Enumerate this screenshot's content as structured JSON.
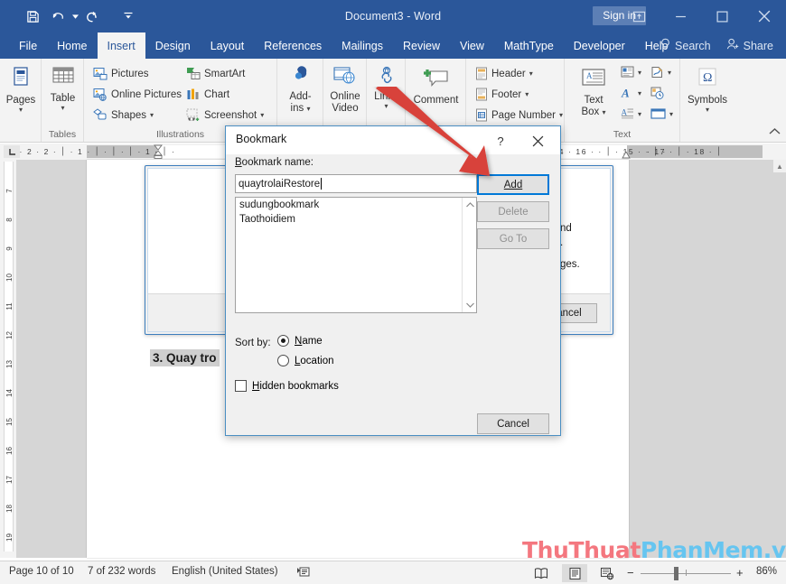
{
  "titlebar": {
    "document_title": "Document3 - Word",
    "sign_in": "Sign in",
    "qat": [
      "save-icon",
      "undo-icon",
      "redo-icon",
      "customize-qat-icon"
    ],
    "window_buttons": [
      "ribbon-display-options-icon",
      "minimize-icon",
      "maximize-icon",
      "close-icon"
    ]
  },
  "ribbon_tabs": {
    "items": [
      {
        "label": "File",
        "active": false
      },
      {
        "label": "Home",
        "active": false
      },
      {
        "label": "Insert",
        "active": true
      },
      {
        "label": "Design",
        "active": false
      },
      {
        "label": "Layout",
        "active": false
      },
      {
        "label": "References",
        "active": false
      },
      {
        "label": "Mailings",
        "active": false
      },
      {
        "label": "Review",
        "active": false
      },
      {
        "label": "View",
        "active": false
      },
      {
        "label": "MathType",
        "active": false
      },
      {
        "label": "Developer",
        "active": false
      },
      {
        "label": "Help",
        "active": false
      }
    ],
    "search": "Search",
    "share": "Share"
  },
  "ribbon": {
    "groups": [
      {
        "name": "Pages",
        "label": ""
      },
      {
        "name": "Tables",
        "label": "Tables"
      },
      {
        "name": "Illustrations",
        "label": "Illustrations"
      },
      {
        "name": "AddIns",
        "label": ""
      },
      {
        "name": "Media",
        "label": ""
      },
      {
        "name": "Links",
        "label": ""
      },
      {
        "name": "Comments",
        "label": ""
      },
      {
        "name": "HeaderFooter",
        "label": ""
      },
      {
        "name": "Text",
        "label": "Text"
      },
      {
        "name": "Symbols",
        "label": ""
      }
    ],
    "pages_button": "Pages",
    "table_button": "Table",
    "pictures": "Pictures",
    "online_pictures": "Online Pictures",
    "shapes": "Shapes",
    "smartart": "SmartArt",
    "chart": "Chart",
    "screenshot": "Screenshot",
    "addins": "Add-ins",
    "online_video_line1": "Online",
    "online_video_line2": "Video",
    "links": "Links",
    "comment": "Comment",
    "header": "Header",
    "footer": "Footer",
    "page_number": "Page Number",
    "text_box_line1": "Text",
    "text_box_line2": "Box",
    "symbols": "Symbols",
    "group_label_tables": "Tables",
    "group_label_illustrations": "Illustrations",
    "group_label_text": "Text",
    "collapse_icon": "chevron-up-icon"
  },
  "ruler": {
    "horizontal": "·  2  ·  ׀  ·  1  ·  ׀  ·  ׀  ·  ׀  ·  1  ·  ׀  ·  2  ·",
    "horizontal_right": "·  14  ·  ׀  ·  · 15  ·  ׀  ·  · 16  ·",
    "horizontal_right2": "·  17  ·   ׀   · 18  ·  ׀",
    "vertical": [
      "7",
      "8",
      "9",
      "10",
      "11",
      "12",
      "13",
      "14",
      "15",
      "16",
      "17",
      "18",
      "19"
    ]
  },
  "document": {
    "heading": "3. Quay tro",
    "bg_dialog_line1": "nd",
    "bg_dialog_line2": ".",
    "bg_dialog_line3": "ges.",
    "bg_dialog_cancel": "ancel"
  },
  "bookmark_dialog": {
    "title": "Bookmark",
    "help_icon": "question-mark-icon",
    "close_icon": "close-icon",
    "name_label": "Bookmark name:",
    "name_value": "quaytrolaiRestore",
    "bookmarks": [
      "sudungbookmark",
      "Taothoidiem"
    ],
    "buttons": {
      "add": "Add",
      "delete": "Delete",
      "goto": "Go To",
      "cancel": "Cancel"
    },
    "sort_by_label": "Sort by:",
    "sort_options": [
      {
        "label": "Name",
        "selected": true
      },
      {
        "label": "Location",
        "selected": false
      }
    ],
    "hidden_bookmarks_label": "Hidden bookmarks",
    "hidden_bookmarks_checked": false,
    "accent_color": "#0078d7"
  },
  "annotation": {
    "arrow_color": "#d8423a",
    "arrow_name": "red-pointer-arrow"
  },
  "watermark": {
    "part1": "ThuThuat",
    "part2": "PhanMem",
    "part3": ".vn",
    "color1": "#f4777f",
    "color2": "#66c5f0"
  },
  "statusbar": {
    "page": "Page 10 of 10",
    "words": "7 of 232 words",
    "language": "English (United States)",
    "proofing_icon": "proofing-errors-icon",
    "views": [
      "read-mode-icon",
      "print-layout-icon",
      "web-layout-icon"
    ],
    "active_view_index": 1,
    "zoom_out": "−",
    "zoom_in": "+",
    "zoom_level": "86%"
  }
}
